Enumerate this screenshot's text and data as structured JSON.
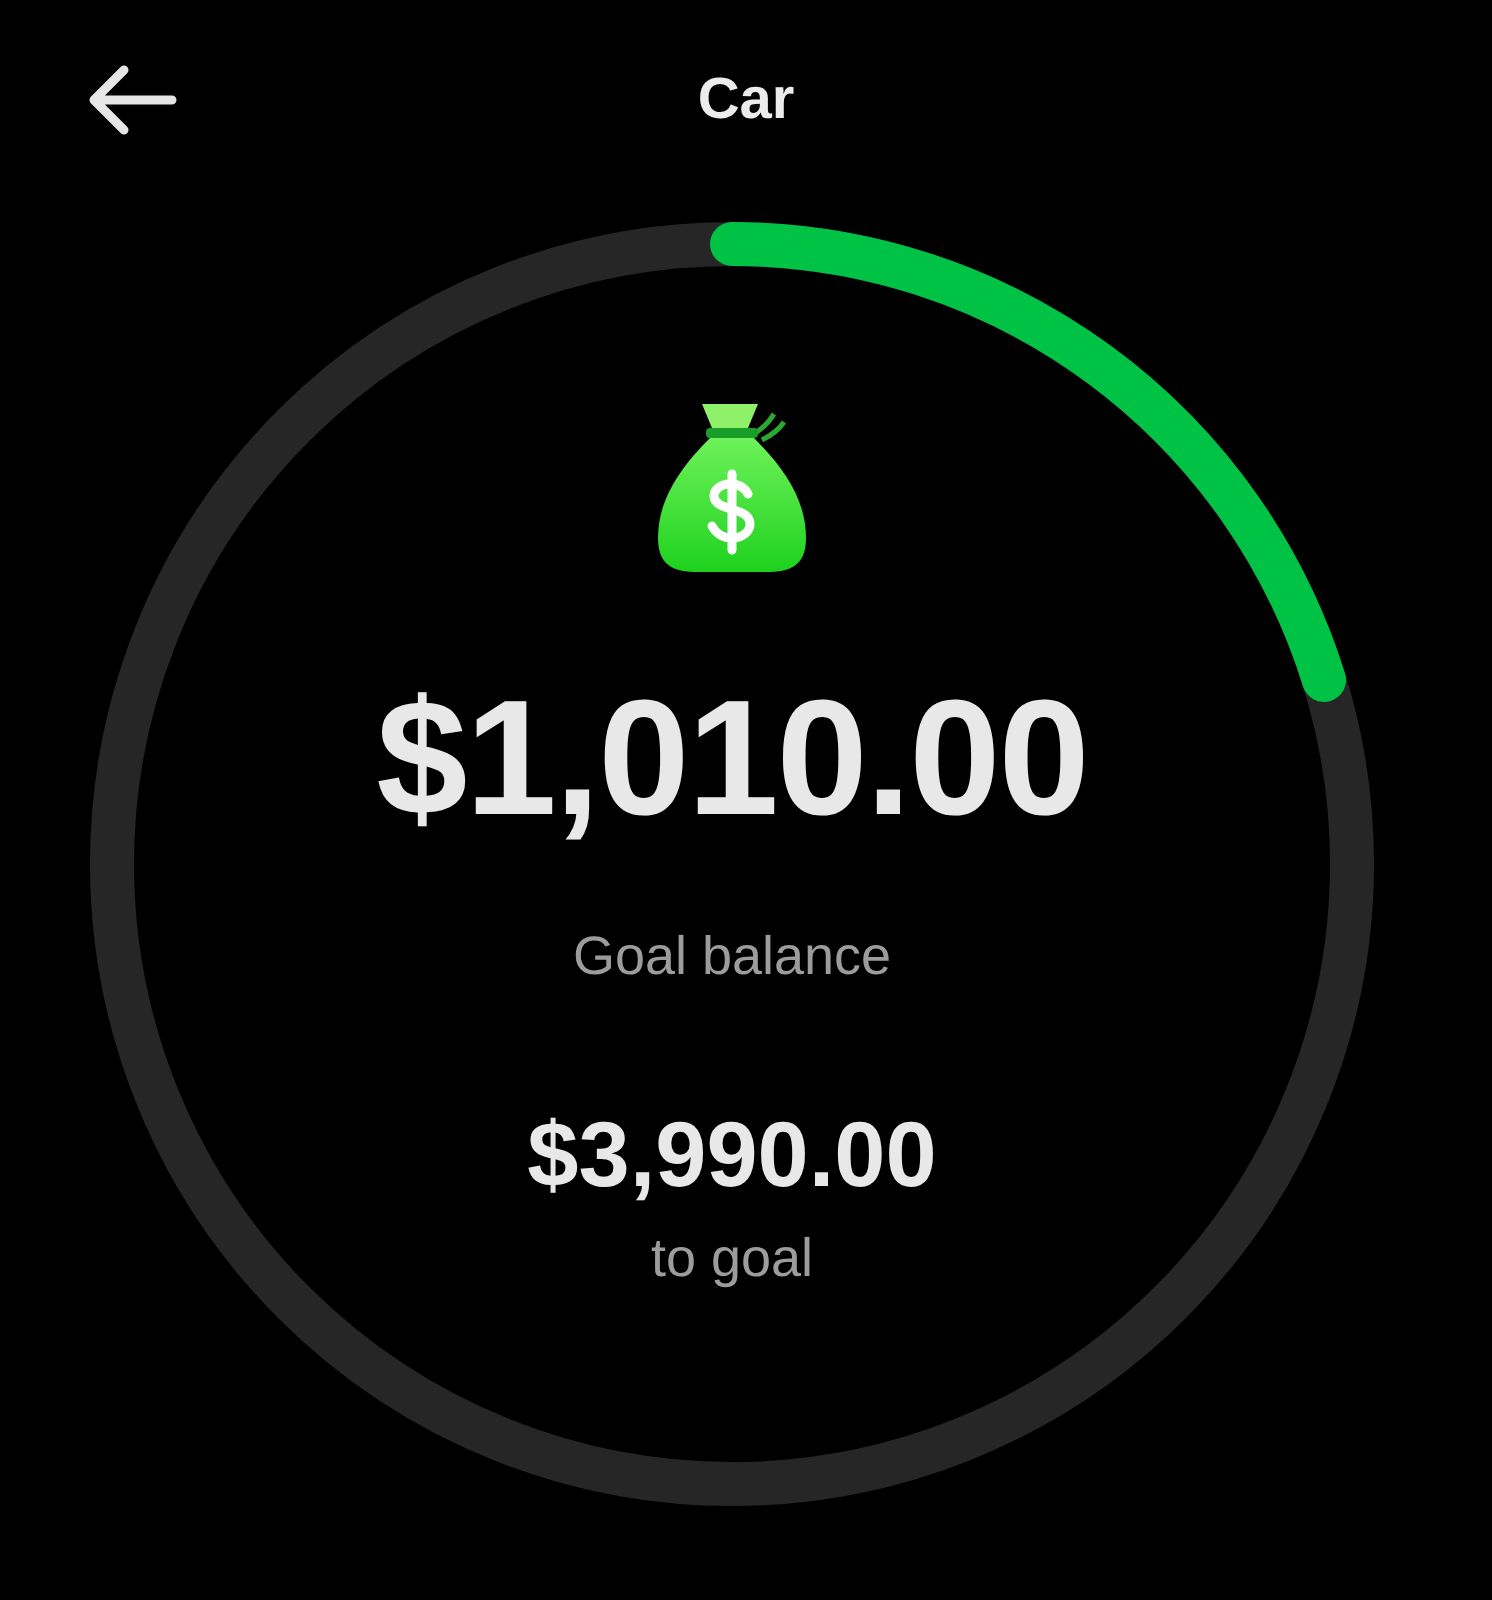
{
  "header": {
    "title": "Car"
  },
  "goal": {
    "level": 0.202,
    "balance": "$1,010.00",
    "balance_label": "Goal balance",
    "remaining": "$3,990.00",
    "remaining_label": "to goal"
  }
}
